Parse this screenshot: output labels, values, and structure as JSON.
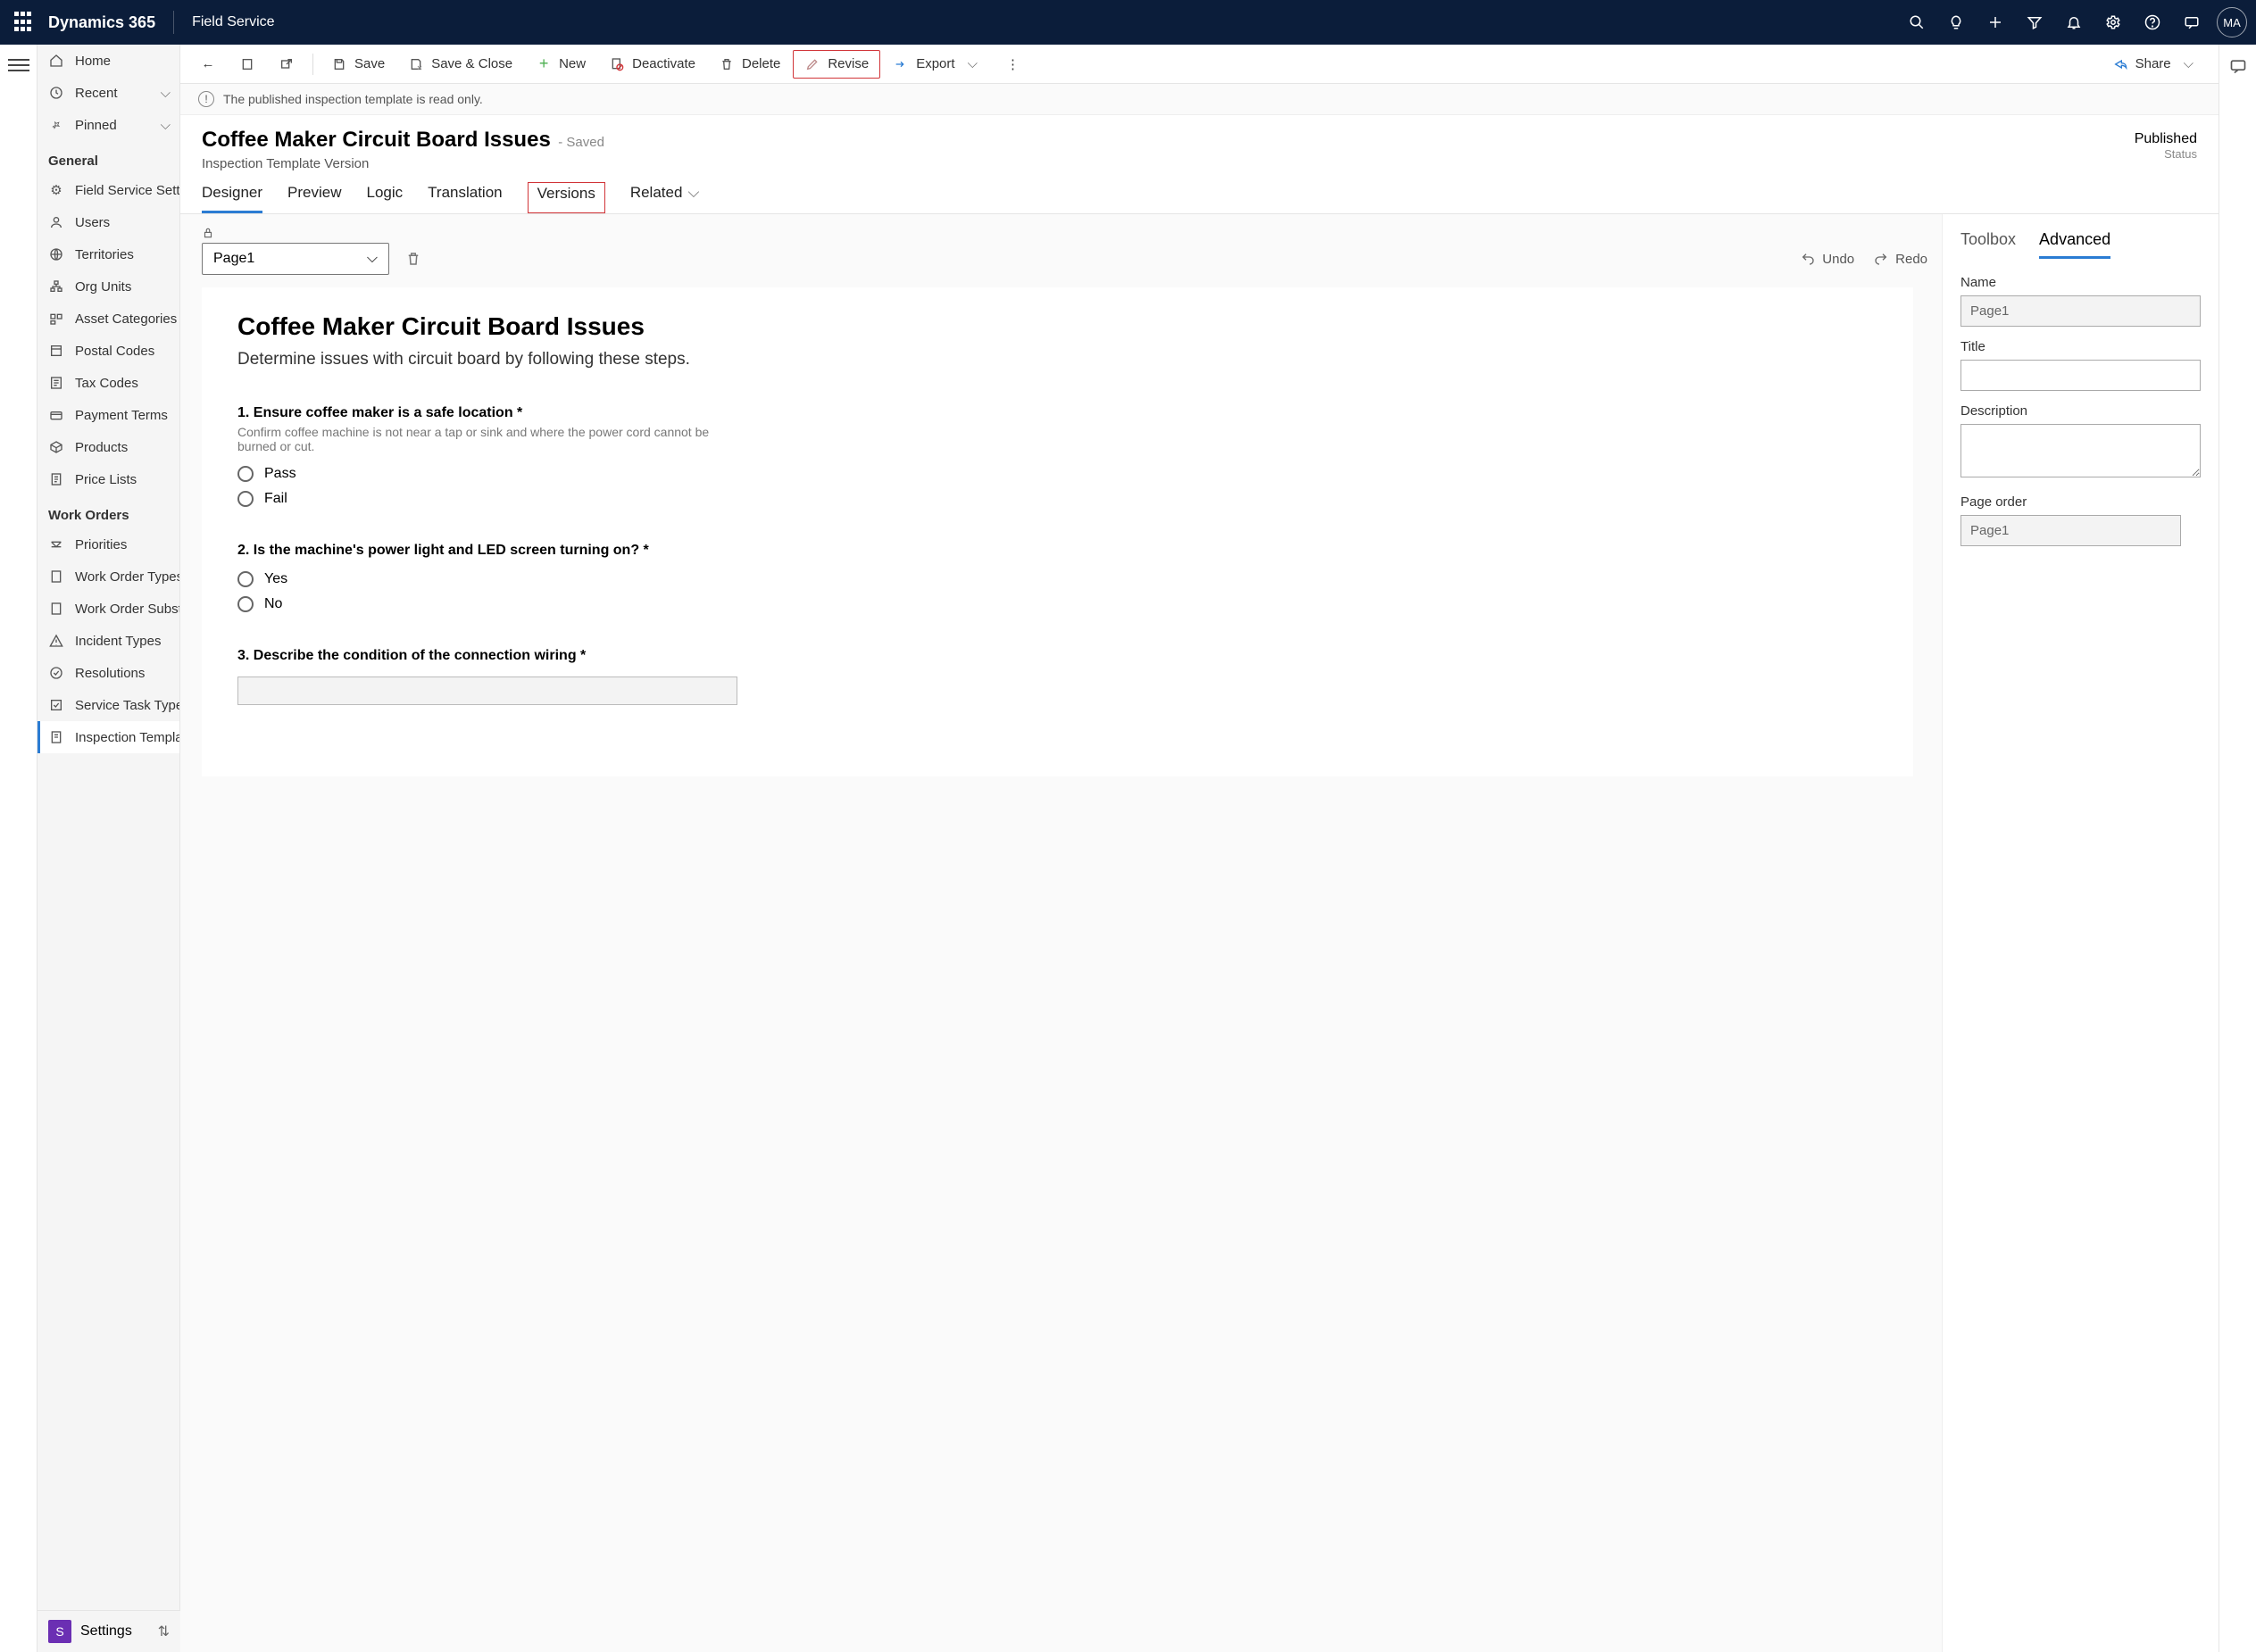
{
  "topbar": {
    "brand": "Dynamics 365",
    "app": "Field Service",
    "avatar": "MA"
  },
  "sidenav": {
    "primary": [
      {
        "label": "Home",
        "icon": "home"
      },
      {
        "label": "Recent",
        "icon": "clock",
        "chev": true
      },
      {
        "label": "Pinned",
        "icon": "pin",
        "chev": true
      }
    ],
    "sections": [
      {
        "title": "General",
        "items": [
          {
            "label": "Field Service Setti...",
            "icon": "gear"
          },
          {
            "label": "Users",
            "icon": "person"
          },
          {
            "label": "Territories",
            "icon": "globe"
          },
          {
            "label": "Org Units",
            "icon": "org"
          },
          {
            "label": "Asset Categories",
            "icon": "asset"
          },
          {
            "label": "Postal Codes",
            "icon": "postal"
          },
          {
            "label": "Tax Codes",
            "icon": "tax"
          },
          {
            "label": "Payment Terms",
            "icon": "payment"
          },
          {
            "label": "Products",
            "icon": "box"
          },
          {
            "label": "Price Lists",
            "icon": "list"
          }
        ]
      },
      {
        "title": "Work Orders",
        "items": [
          {
            "label": "Priorities",
            "icon": "priority"
          },
          {
            "label": "Work Order Types",
            "icon": "doc"
          },
          {
            "label": "Work Order Subst...",
            "icon": "doc"
          },
          {
            "label": "Incident Types",
            "icon": "warn"
          },
          {
            "label": "Resolutions",
            "icon": "check"
          },
          {
            "label": "Service Task Types",
            "icon": "task"
          },
          {
            "label": "Inspection Templa...",
            "icon": "inspect",
            "selected": true
          }
        ]
      }
    ],
    "settings": "Settings"
  },
  "cmdbar": {
    "save": "Save",
    "save_close": "Save & Close",
    "new": "New",
    "deactivate": "Deactivate",
    "delete": "Delete",
    "revise": "Revise",
    "export": "Export",
    "share": "Share"
  },
  "banner": "The published inspection template is read only.",
  "record": {
    "title": "Coffee Maker Circuit Board Issues",
    "saved": "- Saved",
    "subtitle": "Inspection Template Version",
    "status_value": "Published",
    "status_label": "Status"
  },
  "tabs": [
    "Designer",
    "Preview",
    "Logic",
    "Translation",
    "Versions",
    "Related"
  ],
  "designer": {
    "page_selected": "Page1",
    "undo": "Undo",
    "redo": "Redo",
    "canvas_title": "Coffee Maker Circuit Board Issues",
    "canvas_desc": "Determine issues with circuit board by following these steps.",
    "questions": [
      {
        "num": "1.",
        "title": "Ensure coffee maker is a safe location *",
        "hint": "Confirm coffee machine is not near a tap or sink and where the power cord cannot be burned or cut.",
        "options": [
          "Pass",
          "Fail"
        ]
      },
      {
        "num": "2.",
        "title": "Is the machine's power light and LED screen turning on? *",
        "options": [
          "Yes",
          "No"
        ]
      },
      {
        "num": "3.",
        "title": "Describe the condition of the connection wiring *",
        "textarea": true
      }
    ]
  },
  "props": {
    "tabs": [
      "Toolbox",
      "Advanced"
    ],
    "name_label": "Name",
    "name_value": "Page1",
    "title_label": "Title",
    "title_value": "",
    "desc_label": "Description",
    "desc_value": "",
    "order_label": "Page order",
    "order_value": "Page1"
  }
}
